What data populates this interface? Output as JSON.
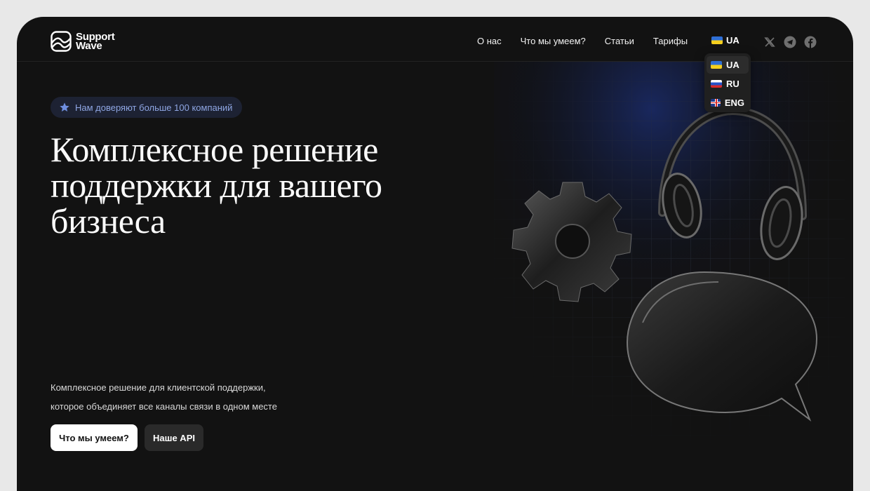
{
  "brand": {
    "name_line1": "Support",
    "name_line2": "Wave"
  },
  "nav": {
    "items": [
      "О нас",
      "Что мы умеем?",
      "Статьи",
      "Тарифы"
    ]
  },
  "language": {
    "current": "UA",
    "options": [
      "UA",
      "RU",
      "ENG"
    ]
  },
  "socials": [
    "x-icon",
    "telegram-icon",
    "facebook-icon"
  ],
  "hero": {
    "badge": "Нам доверяют больше 100 компаний",
    "title": "Комплексное решение поддержки для вашего бизнеса",
    "subtitle_line1": "Комплексное решение для клиентской поддержки,",
    "subtitle_line2": "которое объединяет все каналы связи в одном месте",
    "primary_button": "Что мы умеем?",
    "secondary_button": "Наше API"
  },
  "colors": {
    "background": "#121212",
    "badge_bg": "#1d2233",
    "badge_text": "#8fa6e3",
    "primary_button_bg": "#ffffff"
  }
}
